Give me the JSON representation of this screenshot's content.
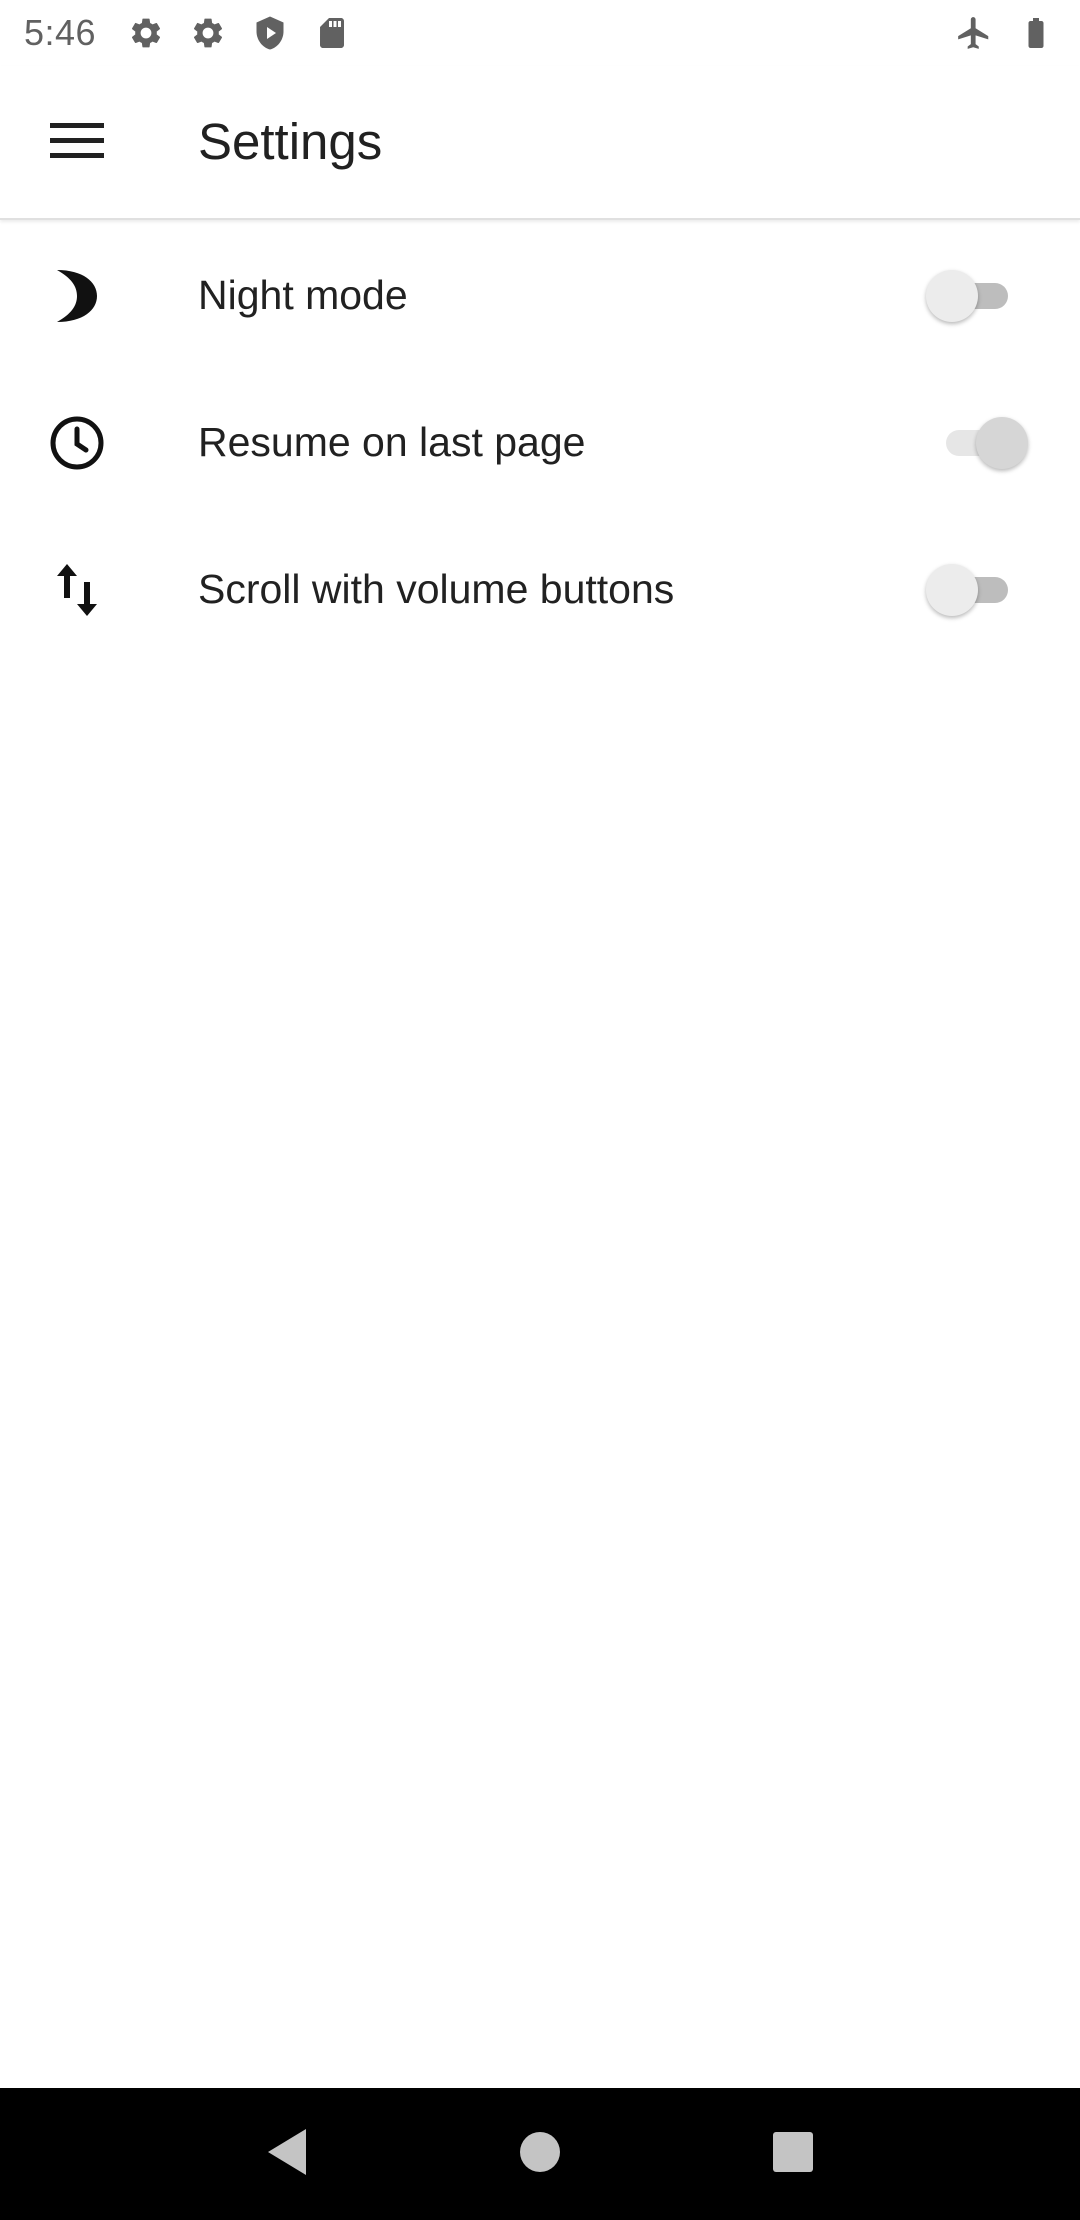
{
  "status_bar": {
    "time": "5:46",
    "left_icons": [
      "settings-icon",
      "settings-icon",
      "play-protect-icon",
      "sd-card-icon"
    ],
    "right_icons": [
      "airplane-mode-icon",
      "battery-icon"
    ]
  },
  "app_bar": {
    "title": "Settings",
    "menu_icon": "menu-icon"
  },
  "settings": [
    {
      "icon": "night-mode-icon",
      "label": "Night mode",
      "enabled": false
    },
    {
      "icon": "clock-icon",
      "label": "Resume on last page",
      "enabled": true
    },
    {
      "icon": "swap-vert-icon",
      "label": "Scroll with volume buttons",
      "enabled": false
    }
  ],
  "nav_bar": {
    "buttons": [
      "back-icon",
      "home-icon",
      "recents-icon"
    ]
  },
  "colors": {
    "text": "#212121",
    "status_icons": "#616161",
    "nav_bar": "#000000",
    "switch_off_track": "#bdbdbd",
    "switch_thumb": "#ececec"
  }
}
